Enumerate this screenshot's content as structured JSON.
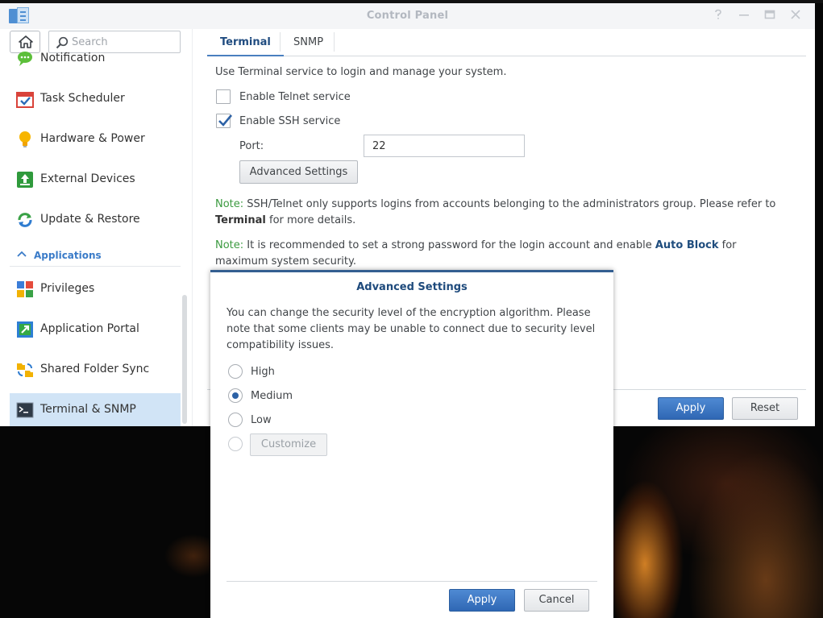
{
  "window": {
    "title": "Control Panel",
    "controls": [
      "help-icon",
      "minimize-icon",
      "maximize-icon",
      "close-icon"
    ]
  },
  "sidebar": {
    "search_placeholder": "Search",
    "items": [
      {
        "label": "Notification",
        "icon": "notification-icon"
      },
      {
        "label": "Task Scheduler",
        "icon": "task-scheduler-icon"
      },
      {
        "label": "Hardware & Power",
        "icon": "lightbulb-icon"
      },
      {
        "label": "External Devices",
        "icon": "external-devices-icon"
      },
      {
        "label": "Update & Restore",
        "icon": "update-restore-icon"
      }
    ],
    "section": "Applications",
    "app_items": [
      {
        "label": "Privileges",
        "icon": "privileges-icon"
      },
      {
        "label": "Application Portal",
        "icon": "application-portal-icon"
      },
      {
        "label": "Shared Folder Sync",
        "icon": "shared-folder-sync-icon"
      },
      {
        "label": "Terminal & SNMP",
        "icon": "terminal-icon",
        "active": true
      }
    ]
  },
  "tabs": [
    {
      "label": "Terminal",
      "active": true
    },
    {
      "label": "SNMP",
      "active": false
    }
  ],
  "terminal": {
    "intro": "Use Terminal service to login and manage your system.",
    "telnet_label": "Enable Telnet service",
    "telnet_checked": false,
    "ssh_label": "Enable SSH service",
    "ssh_checked": true,
    "port_label": "Port:",
    "port_value": "22",
    "advanced_button": "Advanced Settings",
    "note1": {
      "lead": "Note:",
      "text_a": " SSH/Telnet only supports logins from accounts belonging to the administrators group. Please refer to ",
      "link": "Terminal",
      "text_b": " for more details."
    },
    "note2": {
      "lead": "Note:",
      "text_a": " It is recommended to set a strong password for the login account and enable ",
      "link": "Auto Block",
      "text_b": " for maximum system security."
    },
    "apply": "Apply",
    "reset": "Reset"
  },
  "dialog": {
    "title": "Advanced Settings",
    "description": "You can change the security level of the encryption algorithm. Please note that some clients may be unable to connect due to security level compatibility issues.",
    "options": [
      {
        "label": "High",
        "checked": false
      },
      {
        "label": "Medium",
        "checked": true
      },
      {
        "label": "Low",
        "checked": false
      }
    ],
    "customize": "Customize",
    "apply": "Apply",
    "cancel": "Cancel"
  },
  "colors": {
    "accent_blue": "#2f67b4",
    "active_nav": "#d1e4f6",
    "note_green": "#3b9a3f",
    "dialog_border": "#345f91"
  }
}
